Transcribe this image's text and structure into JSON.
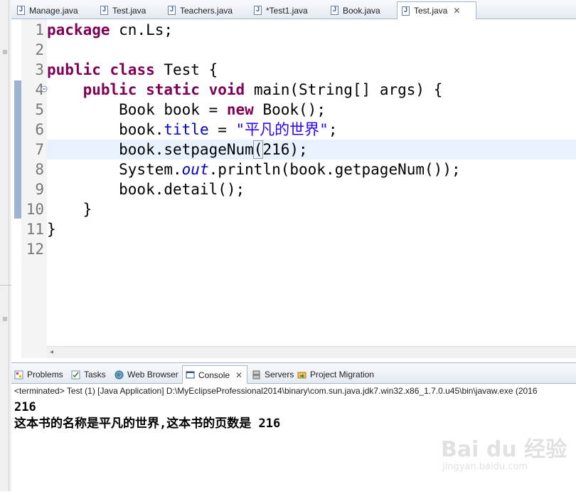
{
  "editor_tabs": [
    {
      "label": "Manage.java",
      "active": false
    },
    {
      "label": "Test.java",
      "active": false
    },
    {
      "label": "Teachers.java",
      "active": false
    },
    {
      "label": "*Test1.java",
      "active": false
    },
    {
      "label": "Book.java",
      "active": false
    },
    {
      "label": "Test.java",
      "active": true
    }
  ],
  "close_glyph": "✕",
  "code": {
    "line_numbers": [
      "1",
      "2",
      "3",
      "4",
      "5",
      "6",
      "7",
      "8",
      "9",
      "10",
      "11",
      "12"
    ],
    "l1": {
      "kw": "package",
      "rest": " cn.Ls;"
    },
    "l3": {
      "kw1": "public",
      "kw2": "class",
      "rest": " Test {"
    },
    "l4": {
      "indent": "    ",
      "kw1": "public",
      "kw2": "static",
      "kw3": "void",
      "rest": " main(String[] args) {"
    },
    "l5": {
      "a": "        Book book = ",
      "kw": "new",
      "b": " Book();"
    },
    "l6": {
      "a": "        book.",
      "field": "title",
      "b": " = ",
      "str": "\"平凡的世界\"",
      "c": ";"
    },
    "l7": {
      "a": "        book.setpageNum",
      "paren": "(",
      "b": "216);"
    },
    "l8": {
      "a": "        System.",
      "out": "out",
      "b": ".println(book.getpageNum());"
    },
    "l9": {
      "a": "        book.detail();"
    },
    "l10": {
      "a": "    }"
    },
    "l11": {
      "a": "}"
    }
  },
  "scroll_left_glyph": "◂",
  "panel_tabs": [
    {
      "label": "Problems",
      "icon": "problems-icon",
      "active": false
    },
    {
      "label": "Tasks",
      "icon": "tasks-icon",
      "active": false
    },
    {
      "label": "Web Browser",
      "icon": "globe-icon",
      "active": false
    },
    {
      "label": "Console",
      "icon": "console-icon",
      "active": true
    },
    {
      "label": "Servers",
      "icon": "servers-icon",
      "active": false
    },
    {
      "label": "Project Migration",
      "icon": "migration-icon",
      "active": false
    }
  ],
  "console": {
    "status": "<terminated> Test (1) [Java Application] D:\\MyEclipseProfessional2014\\binary\\com.sun.java.jdk7.win32.x86_1.7.0.u45\\bin\\javaw.exe (2016",
    "output": [
      "216",
      "这本书的名称是平凡的世界,这本书的页数是 216"
    ]
  },
  "watermark": {
    "brand": "Bai du 经验",
    "url": "jingyan.baidu.com"
  },
  "colors": {
    "keyword": "#7f0055",
    "field": "#0000c0",
    "string": "#2a00ff",
    "current_line": "#e8f2fe"
  }
}
